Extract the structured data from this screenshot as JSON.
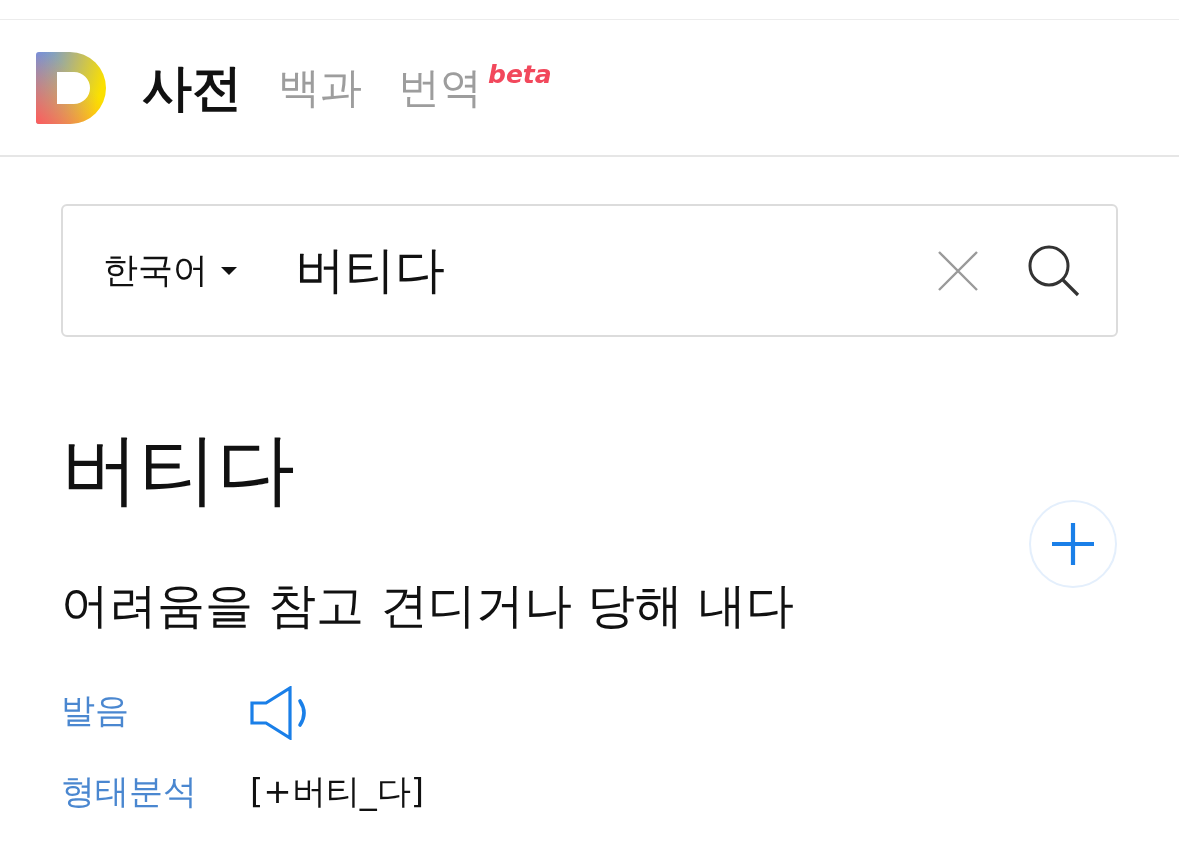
{
  "header": {
    "tabs": [
      {
        "label": "사전",
        "selected": true
      },
      {
        "label": "백과",
        "selected": false
      },
      {
        "label": "번역",
        "selected": false,
        "badge": "beta"
      }
    ]
  },
  "search": {
    "language": "한국어",
    "value": "버티다"
  },
  "entry": {
    "headword": "버티다",
    "definition": "어려움을 참고 견디거나 당해 내다",
    "details": [
      {
        "kind": "audio",
        "label": "발음"
      },
      {
        "kind": "text",
        "label": "형태분석",
        "value": "[+버티_다]"
      }
    ]
  }
}
